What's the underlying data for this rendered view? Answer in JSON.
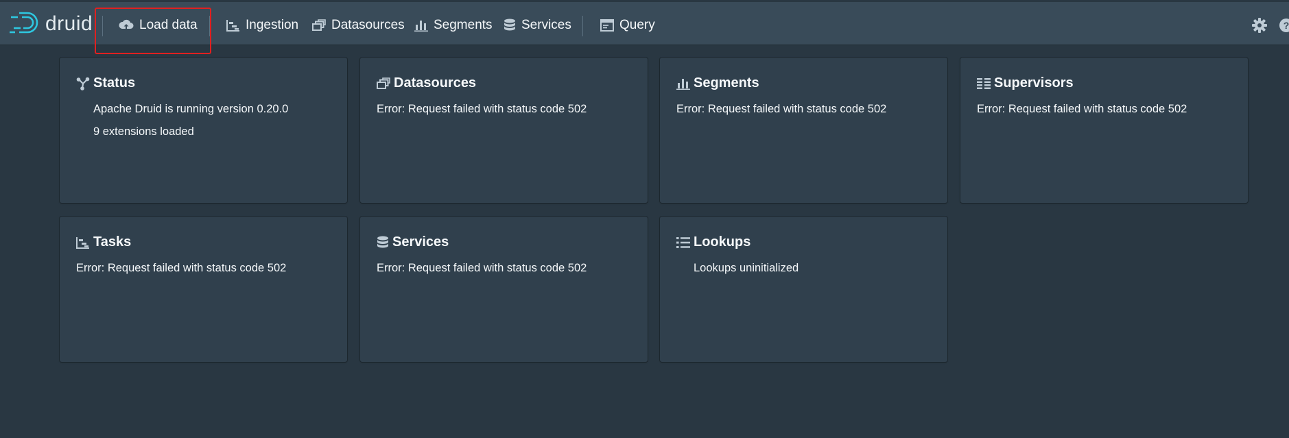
{
  "app": {
    "logo_text": "druid"
  },
  "nav": {
    "load_data": "Load data",
    "ingestion": "Ingestion",
    "datasources": "Datasources",
    "segments": "Segments",
    "services": "Services",
    "query": "Query"
  },
  "cards": {
    "status": {
      "title": "Status",
      "line1": "Apache Druid is running version 0.20.0",
      "line2": "9 extensions loaded"
    },
    "datasources": {
      "title": "Datasources",
      "line1": "Error: Request failed with status code 502"
    },
    "segments": {
      "title": "Segments",
      "line1": "Error: Request failed with status code 502"
    },
    "supervisors": {
      "title": "Supervisors",
      "line1": "Error: Request failed with status code 502"
    },
    "tasks": {
      "title": "Tasks",
      "line1": "Error: Request failed with status code 502"
    },
    "services": {
      "title": "Services",
      "line1": "Error: Request failed with status code 502"
    },
    "lookups": {
      "title": "Lookups",
      "line1": "Lookups uninitialized"
    }
  },
  "icons": {
    "logo": "druid-logo-icon",
    "load_data": "cloud-upload-icon",
    "ingestion": "gantt-chart-icon",
    "datasources": "multi-select-icon",
    "segments": "stacked-chart-icon",
    "services": "database-icon",
    "query": "application-icon",
    "settings": "cog-icon",
    "help": "help-icon",
    "status": "graph-icon",
    "supervisors": "list-columns-icon",
    "lookups": "properties-icon"
  },
  "colors": {
    "background": "#293742",
    "topbar": "#394b59",
    "card": "#30404d",
    "logo_accent": "#2ec7e0",
    "highlight": "#e02020"
  }
}
